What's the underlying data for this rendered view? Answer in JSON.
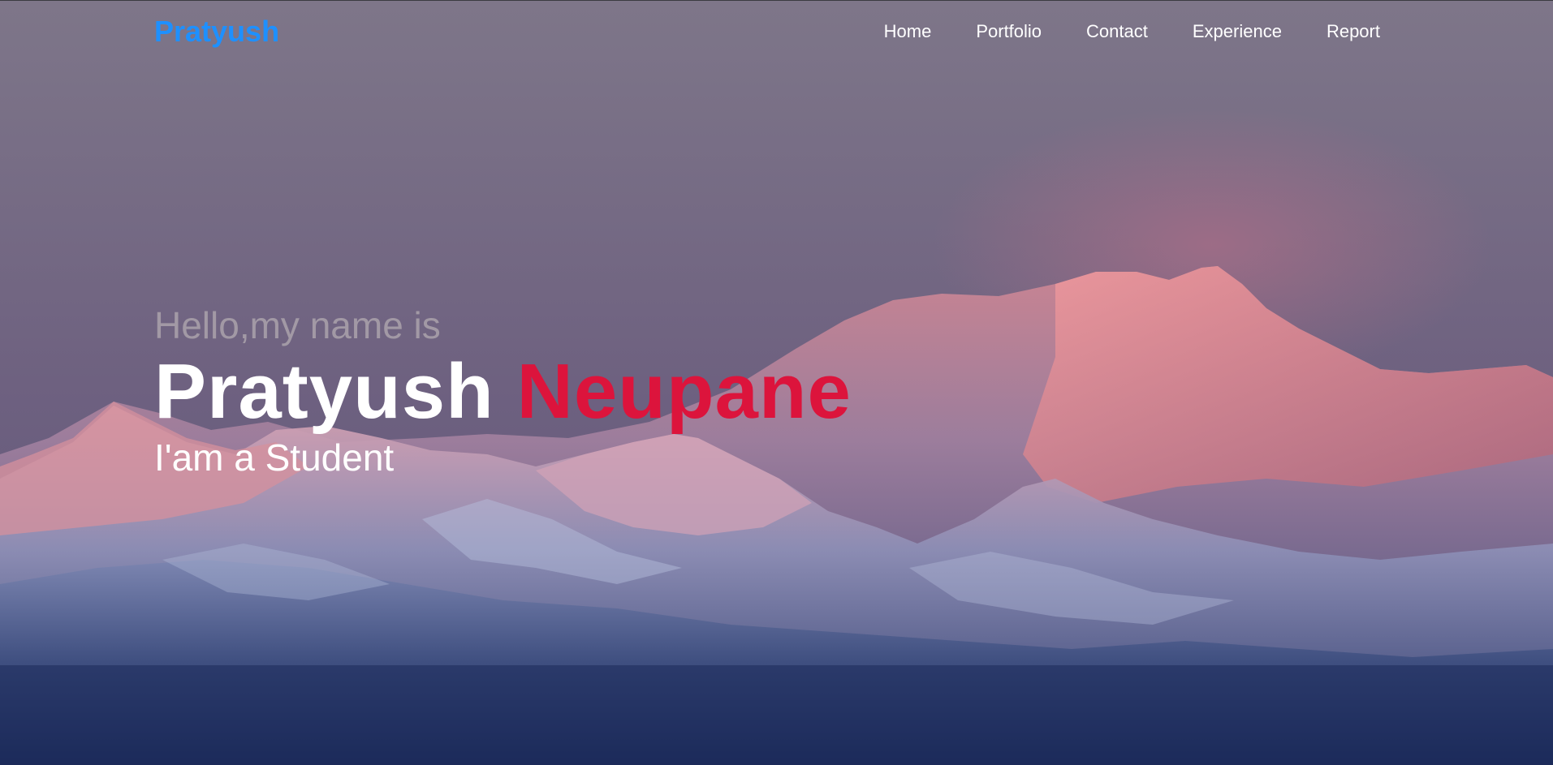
{
  "nav": {
    "brand": "Pratyush",
    "links": [
      "Home",
      "Portfolio",
      "Contact",
      "Experience",
      "Report"
    ]
  },
  "hero": {
    "greeting": "Hello,my name is",
    "first_name": "Pratyush",
    "last_name": "Neupane",
    "role": "I'am a Student"
  },
  "colors": {
    "brand": "#1e90ff",
    "accent": "#dc143c",
    "text": "#ffffff"
  },
  "background": {
    "description_icon": "mountain-landscape-image"
  }
}
